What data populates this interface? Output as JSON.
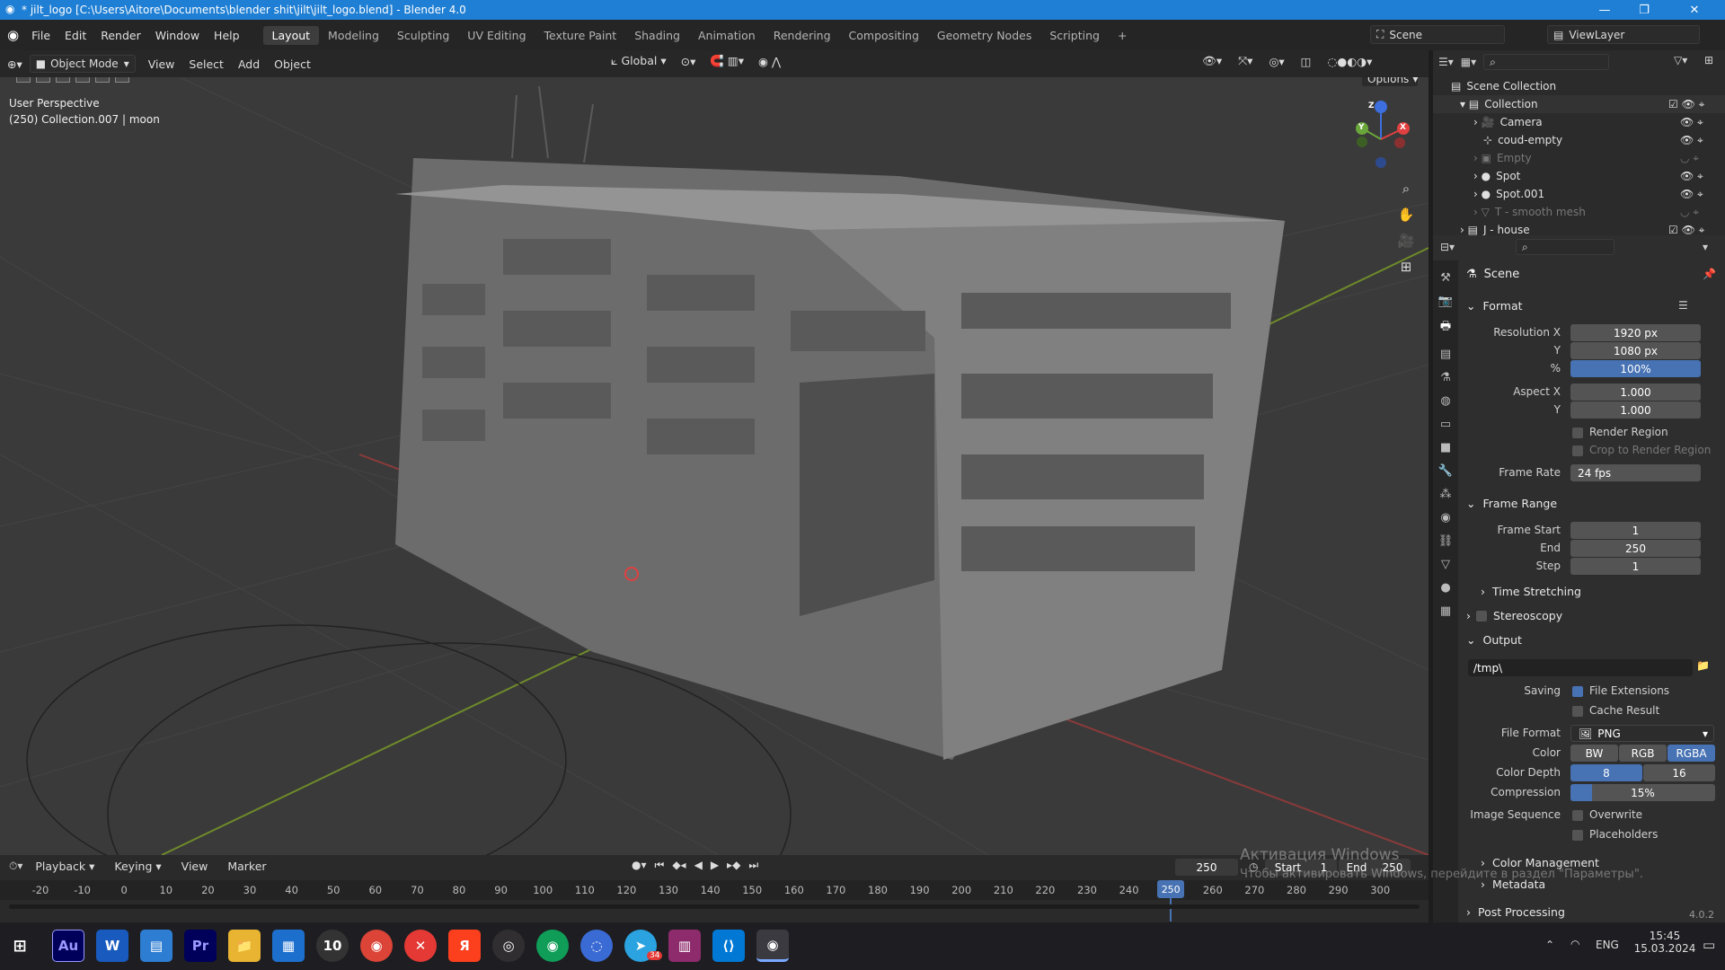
{
  "window": {
    "title": "* jilt_logo [C:\\Users\\Aitore\\Documents\\blender shit\\jilt\\jilt_logo.blend] - Blender 4.0"
  },
  "menus": [
    "File",
    "Edit",
    "Render",
    "Window",
    "Help"
  ],
  "workspaces": [
    "Layout",
    "Modeling",
    "Sculpting",
    "UV Editing",
    "Texture Paint",
    "Shading",
    "Animation",
    "Rendering",
    "Compositing",
    "Geometry Nodes",
    "Scripting"
  ],
  "active_workspace": "Layout",
  "scene_selector": "Scene",
  "view_layer": "ViewLayer",
  "viewport_header": {
    "mode": "Object Mode",
    "menus": [
      "View",
      "Select",
      "Add",
      "Object"
    ],
    "transform_orientation": "Global",
    "options_label": "Options"
  },
  "viewport": {
    "perspective": "User Perspective",
    "context": "(250) Collection.007 | moon",
    "gizmo_axes": [
      "X",
      "Y",
      "Z"
    ]
  },
  "outliner": {
    "rows": [
      {
        "name": "Scene Collection",
        "level": 0
      },
      {
        "name": "Collection",
        "level": 1
      },
      {
        "name": "Camera",
        "level": 2
      },
      {
        "name": "coud-empty",
        "level": 2
      },
      {
        "name": "Empty",
        "level": 2
      },
      {
        "name": "Spot",
        "level": 2
      },
      {
        "name": "Spot.001",
        "level": 2
      },
      {
        "name": "T - smooth mesh",
        "level": 2
      },
      {
        "name": "J - house",
        "level": 1
      }
    ]
  },
  "properties": {
    "context": "Scene",
    "format_section": "Format",
    "resolution_x_label": "Resolution X",
    "resolution_x": "1920 px",
    "resolution_y_label": "Y",
    "resolution_y": "1080 px",
    "resolution_pct_label": "%",
    "resolution_pct": "100%",
    "aspect_x_label": "Aspect X",
    "aspect_x": "1.000",
    "aspect_y_label": "Y",
    "aspect_y": "1.000",
    "render_region": "Render Region",
    "crop_region": "Crop to Render Region",
    "frame_rate_label": "Frame Rate",
    "frame_rate": "24 fps",
    "frame_range_section": "Frame Range",
    "frame_start_label": "Frame Start",
    "frame_start": "1",
    "end_label": "End",
    "end": "250",
    "step_label": "Step",
    "step": "1",
    "time_stretching": "Time Stretching",
    "stereoscopy": "Stereoscopy",
    "output_section": "Output",
    "output_path": "/tmp\\",
    "saving_label": "Saving",
    "file_extensions": "File Extensions",
    "cache_result": "Cache Result",
    "file_format_label": "File Format",
    "file_format": "PNG",
    "color_label": "Color",
    "color_options": [
      "BW",
      "RGB",
      "RGBA"
    ],
    "color_selected": "RGBA",
    "color_depth_label": "Color Depth",
    "color_depth_options": [
      "8",
      "16"
    ],
    "compression_label": "Compression",
    "compression": "15%",
    "compression_level": 0.15,
    "image_sequence_label": "Image Sequence",
    "overwrite": "Overwrite",
    "placeholders": "Placeholders",
    "color_management": "Color Management",
    "metadata": "Metadata",
    "post_processing": "Post Processing"
  },
  "timeline": {
    "menus": [
      "Playback",
      "Keying",
      "View",
      "Marker"
    ],
    "current_frame": "250",
    "start_label": "Start",
    "start": "1",
    "end_label": "End",
    "end": "250",
    "ruler": [
      "-20",
      "-10",
      "0",
      "10",
      "20",
      "30",
      "40",
      "50",
      "60",
      "70",
      "80",
      "90",
      "100",
      "110",
      "120",
      "130",
      "140",
      "150",
      "160",
      "170",
      "180",
      "190",
      "200",
      "210",
      "220",
      "230",
      "240",
      "250",
      "260",
      "270",
      "280",
      "290",
      "300"
    ],
    "playhead": "250"
  },
  "status": {
    "version": "4.0.2",
    "activation_title": "Активация Windows",
    "activation_text": "Чтобы активировать Windows, перейдите в раздел \"Параметры\"."
  },
  "taskbar": {
    "apps": [
      "start-icon",
      "audition-icon",
      "word-icon",
      "notepad-icon",
      "premiere-icon",
      "explorer-icon",
      "store-icon",
      "app-10-icon",
      "chrome-icon",
      "xmind-icon",
      "yandex-icon",
      "obs-icon",
      "chrome-profile-icon",
      "app-circle-icon",
      "telegram-icon",
      "winrar-icon",
      "vscode-icon",
      "blender-icon"
    ],
    "app_labels": [
      "",
      "Au",
      "W",
      "",
      "Pr",
      "",
      "",
      "10",
      "",
      "✕",
      "Я",
      "",
      "",
      "",
      "",
      "",
      "",
      ""
    ],
    "telegram_badge": "34",
    "lang": "ENG",
    "time": "15:45",
    "date": "15.03.2024"
  }
}
